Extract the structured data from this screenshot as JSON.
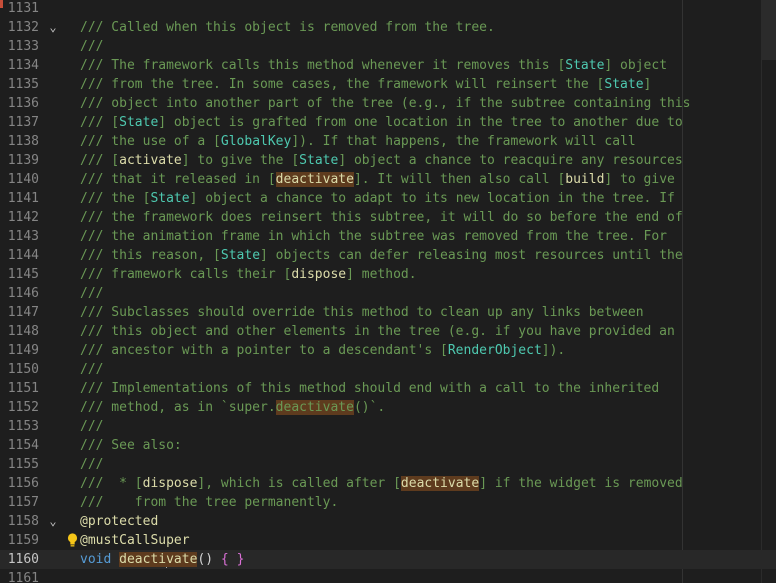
{
  "editor": {
    "lines": [
      {
        "num": "1131",
        "segs": []
      },
      {
        "num": "1132",
        "fold": "⌄",
        "segs": [
          {
            "t": "/// Called when this object is removed from the tree.",
            "c": "c"
          }
        ]
      },
      {
        "num": "1133",
        "segs": [
          {
            "t": "///",
            "c": "c"
          }
        ]
      },
      {
        "num": "1134",
        "segs": [
          {
            "t": "/// The framework calls this method whenever it removes this ",
            "c": "c"
          },
          {
            "t": "[",
            "c": "c"
          },
          {
            "t": "State",
            "c": "ref"
          },
          {
            "t": "] object",
            "c": "c"
          }
        ]
      },
      {
        "num": "1135",
        "segs": [
          {
            "t": "/// from the tree. In some cases, the framework will reinsert the [",
            "c": "c"
          },
          {
            "t": "State",
            "c": "ref"
          },
          {
            "t": "]",
            "c": "c"
          }
        ]
      },
      {
        "num": "1136",
        "segs": [
          {
            "t": "/// object into another part of the tree (e.g., if the subtree containing this",
            "c": "c"
          }
        ]
      },
      {
        "num": "1137",
        "segs": [
          {
            "t": "/// [",
            "c": "c"
          },
          {
            "t": "State",
            "c": "ref"
          },
          {
            "t": "] object is grafted from one location in the tree to another due to",
            "c": "c"
          }
        ]
      },
      {
        "num": "1138",
        "segs": [
          {
            "t": "/// the use of a [",
            "c": "c"
          },
          {
            "t": "GlobalKey",
            "c": "ref"
          },
          {
            "t": "]). If that happens, the framework will call",
            "c": "c"
          }
        ]
      },
      {
        "num": "1139",
        "segs": [
          {
            "t": "/// [",
            "c": "c"
          },
          {
            "t": "activate",
            "c": "dispose-c"
          },
          {
            "t": "] to give the [",
            "c": "c"
          },
          {
            "t": "State",
            "c": "ref"
          },
          {
            "t": "] object a chance to reacquire any resources",
            "c": "c"
          }
        ]
      },
      {
        "num": "1140",
        "segs": [
          {
            "t": "/// that it released in [",
            "c": "c"
          },
          {
            "t": "deactivate",
            "c": "hl"
          },
          {
            "t": "]. It will then also call [",
            "c": "c"
          },
          {
            "t": "build",
            "c": "dispose-c"
          },
          {
            "t": "] to give",
            "c": "c"
          }
        ]
      },
      {
        "num": "1141",
        "segs": [
          {
            "t": "/// the [",
            "c": "c"
          },
          {
            "t": "State",
            "c": "ref"
          },
          {
            "t": "] object a chance to adapt to its new location in the tree. If",
            "c": "c"
          }
        ]
      },
      {
        "num": "1142",
        "segs": [
          {
            "t": "/// the framework does reinsert this subtree, it will do so before the end of",
            "c": "c"
          }
        ]
      },
      {
        "num": "1143",
        "segs": [
          {
            "t": "/// the animation frame in which the subtree was removed from the tree. For",
            "c": "c"
          }
        ]
      },
      {
        "num": "1144",
        "segs": [
          {
            "t": "/// this reason, [",
            "c": "c"
          },
          {
            "t": "State",
            "c": "ref"
          },
          {
            "t": "] objects can defer releasing most resources until the",
            "c": "c"
          }
        ]
      },
      {
        "num": "1145",
        "segs": [
          {
            "t": "/// framework calls their [",
            "c": "c"
          },
          {
            "t": "dispose",
            "c": "dispose-c"
          },
          {
            "t": "] method.",
            "c": "c"
          }
        ]
      },
      {
        "num": "1146",
        "segs": [
          {
            "t": "///",
            "c": "c"
          }
        ]
      },
      {
        "num": "1147",
        "segs": [
          {
            "t": "/// Subclasses should override this method to clean up any links between",
            "c": "c"
          }
        ]
      },
      {
        "num": "1148",
        "segs": [
          {
            "t": "/// this object and other elements in the tree (e.g. if you have provided an",
            "c": "c"
          }
        ]
      },
      {
        "num": "1149",
        "segs": [
          {
            "t": "/// ancestor with a pointer to a descendant's [",
            "c": "c"
          },
          {
            "t": "RenderObject",
            "c": "ref"
          },
          {
            "t": "]).",
            "c": "c"
          }
        ]
      },
      {
        "num": "1150",
        "segs": [
          {
            "t": "///",
            "c": "c"
          }
        ]
      },
      {
        "num": "1151",
        "segs": [
          {
            "t": "/// Implementations of this method should end with a call to the inherited",
            "c": "c"
          }
        ]
      },
      {
        "num": "1152",
        "segs": [
          {
            "t": "/// method, as in `super.",
            "c": "c"
          },
          {
            "t": "deactivate",
            "c": "hlc-c"
          },
          {
            "t": "()`.",
            "c": "c"
          }
        ]
      },
      {
        "num": "1153",
        "segs": [
          {
            "t": "///",
            "c": "c"
          }
        ]
      },
      {
        "num": "1154",
        "segs": [
          {
            "t": "/// See also:",
            "c": "c"
          }
        ]
      },
      {
        "num": "1155",
        "segs": [
          {
            "t": "///",
            "c": "c"
          }
        ]
      },
      {
        "num": "1156",
        "segs": [
          {
            "t": "///  * [",
            "c": "c"
          },
          {
            "t": "dispose",
            "c": "dispose-c"
          },
          {
            "t": "], which is called after [",
            "c": "c"
          },
          {
            "t": "deactivate",
            "c": "hl"
          },
          {
            "t": "] if the widget is removed",
            "c": "c"
          }
        ]
      },
      {
        "num": "1157",
        "segs": [
          {
            "t": "///    from the tree permanently.",
            "c": "c"
          }
        ]
      },
      {
        "num": "1158",
        "fold": "⌄",
        "segs": [
          {
            "t": "@protected",
            "c": "fn"
          }
        ]
      },
      {
        "num": "1159",
        "bulb": true,
        "segs": [
          {
            "t": "@mustCallSuper",
            "c": "fn"
          }
        ]
      },
      {
        "num": "1160",
        "current": true,
        "segs": [
          {
            "t": "void ",
            "c": "kw"
          },
          {
            "t": "deacti",
            "c": "hl"
          },
          {
            "t": "|cursor|",
            "c": "cursor"
          },
          {
            "t": "vate",
            "c": "hl"
          },
          {
            "t": "() ",
            "c": "p"
          },
          {
            "t": "{",
            "c": "brace"
          },
          {
            "t": " ",
            "c": "p"
          },
          {
            "t": "}",
            "c": "brace"
          }
        ]
      },
      {
        "num": "1161",
        "segs": []
      }
    ]
  }
}
